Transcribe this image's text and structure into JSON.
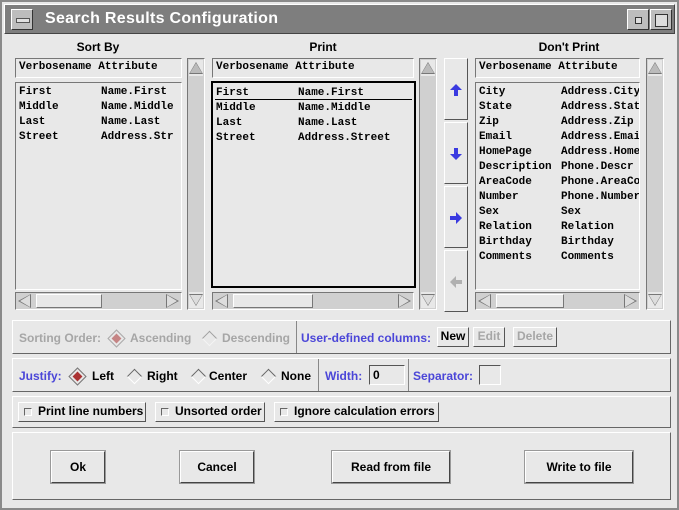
{
  "window": {
    "title": "Search Results Configuration"
  },
  "columns": {
    "sort_by": "Sort By",
    "print": "Print",
    "dont_print": "Don't Print"
  },
  "list_header": {
    "col1": "Verbosename",
    "col2": "Attribute"
  },
  "sort_by_rows": [
    {
      "name": "First",
      "attr": "Name.First"
    },
    {
      "name": "Middle",
      "attr": "Name.Middle"
    },
    {
      "name": "Last",
      "attr": "Name.Last"
    },
    {
      "name": "Street",
      "attr": "Address.Str"
    }
  ],
  "print_rows": [
    {
      "name": "First",
      "attr": "Name.First"
    },
    {
      "name": "Middle",
      "attr": "Name.Middle"
    },
    {
      "name": "Last",
      "attr": "Name.Last"
    },
    {
      "name": "Street",
      "attr": "Address.Street"
    }
  ],
  "dont_print_rows": [
    {
      "name": "City",
      "attr": "Address.City"
    },
    {
      "name": "State",
      "attr": "Address.Stat"
    },
    {
      "name": "Zip",
      "attr": "Address.Zip"
    },
    {
      "name": "Email",
      "attr": "Address.Emai"
    },
    {
      "name": "HomePage",
      "attr": "Address.Home"
    },
    {
      "name": "Description",
      "attr": "Phone.Descr"
    },
    {
      "name": "AreaCode",
      "attr": "Phone.AreaCo"
    },
    {
      "name": "Number",
      "attr": "Phone.Number"
    },
    {
      "name": "Sex",
      "attr": "Sex"
    },
    {
      "name": "Relation",
      "attr": "Relation"
    },
    {
      "name": "Birthday",
      "attr": "Birthday"
    },
    {
      "name": "Comments",
      "attr": "Comments"
    }
  ],
  "sorting": {
    "label": "Sorting Order:",
    "ascending": "Ascending",
    "descending": "Descending",
    "selected": "Ascending"
  },
  "user_columns": {
    "label": "User-defined columns:",
    "new": "New",
    "edit": "Edit",
    "delete": "Delete"
  },
  "justify": {
    "label": "Justify:",
    "left": "Left",
    "right": "Right",
    "center": "Center",
    "none": "None",
    "selected": "Left"
  },
  "width": {
    "label": "Width:",
    "value": "0"
  },
  "separator": {
    "label": "Separator:",
    "value": ""
  },
  "options": {
    "print_line_numbers": "Print line numbers",
    "unsorted_order": "Unsorted order",
    "ignore_calc_errors": "Ignore calculation errors"
  },
  "buttons": {
    "ok": "Ok",
    "cancel": "Cancel",
    "read_from_file": "Read from file",
    "write_to_file": "Write to file"
  },
  "colors": {
    "accent_blue": "#4b46d8",
    "arrow_blue": "#3a3ae0",
    "radio_selected": "#aa3333",
    "titlebar": "#7e7e7e"
  }
}
